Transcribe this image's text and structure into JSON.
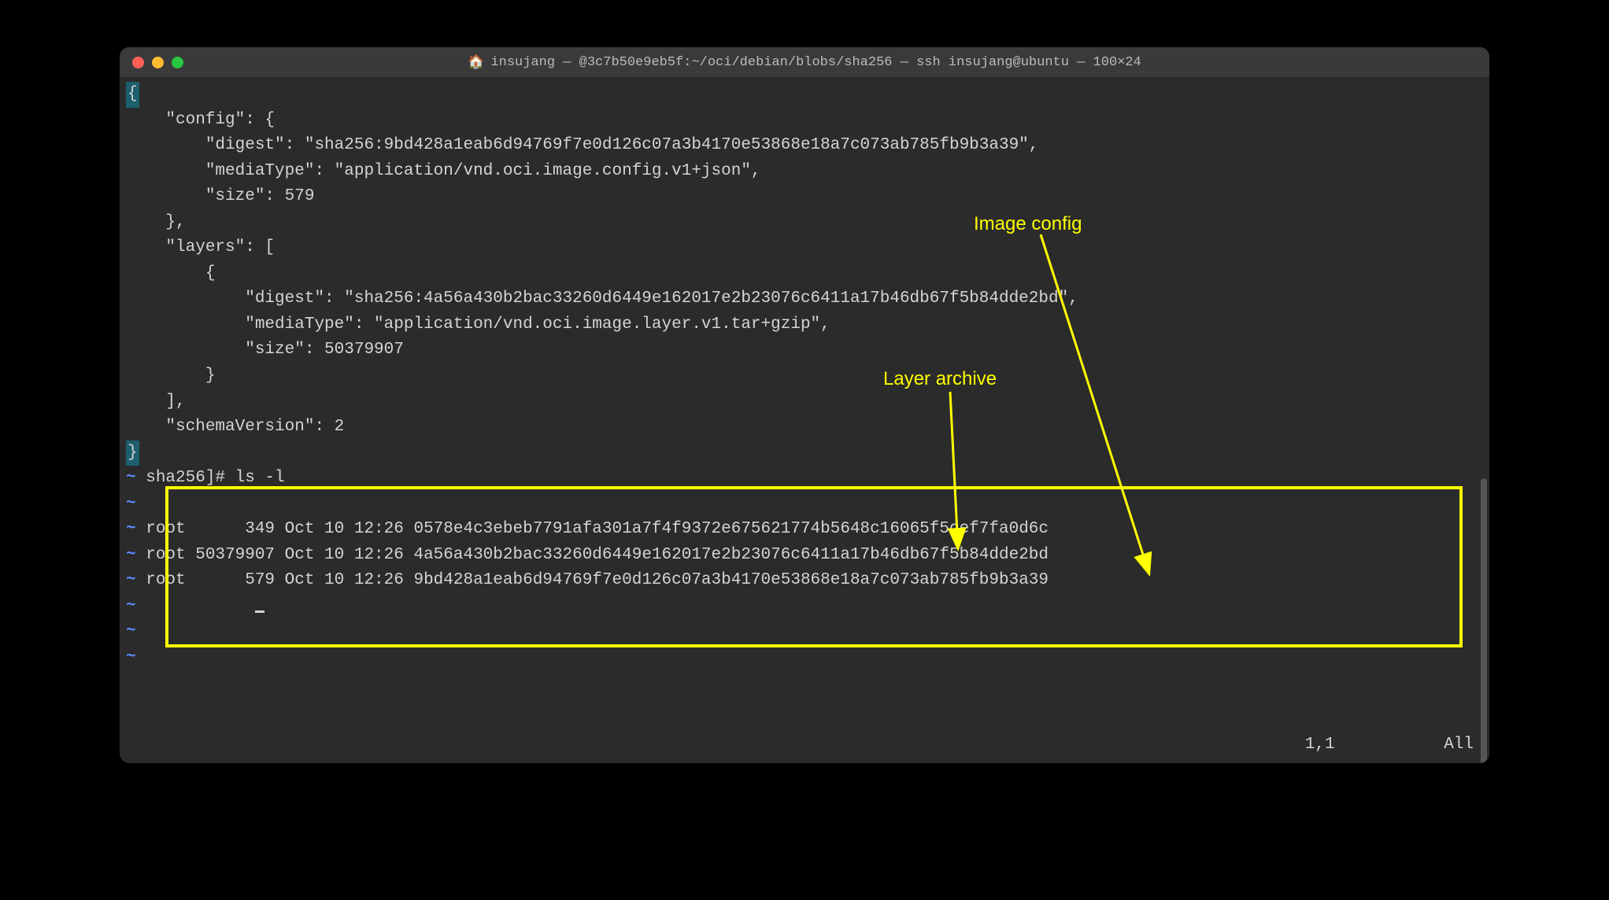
{
  "titlebar": {
    "home_icon": "🏠",
    "title": "insujang — @3c7b50e9eb5f:~/oci/debian/blobs/sha256 — ssh insujang@ubuntu — 100×24"
  },
  "json_output": {
    "open_brace": "{",
    "line1": "    \"config\": {",
    "line2": "        \"digest\": \"sha256:9bd428a1eab6d94769f7e0d126c07a3b4170e53868e18a7c073ab785fb9b3a39\",",
    "line3": "        \"mediaType\": \"application/vnd.oci.image.config.v1+json\",",
    "line4": "        \"size\": 579",
    "line5": "    },",
    "line6": "    \"layers\": [",
    "line7": "        {",
    "line8": "            \"digest\": \"sha256:4a56a430b2bac33260d6449e162017e2b23076c6411a17b46db67f5b84dde2bd\",",
    "line9": "            \"mediaType\": \"application/vnd.oci.image.layer.v1.tar+gzip\",",
    "line10": "            \"size\": 50379907",
    "line11": "        }",
    "line12": "    ],",
    "line13": "    \"schemaVersion\": 2",
    "close_brace": "}"
  },
  "ls_command": {
    "prompt_line": " sha256]# ls -l",
    "blank": "",
    "row1": " root      349 Oct 10 12:26 0578e4c3ebeb7791afa301a7f4f9372e675621774b5648c16065f5cef7fa0d6c",
    "row2": " root 50379907 Oct 10 12:26 4a56a430b2bac33260d6449e162017e2b23076c6411a17b46db67f5b84dde2bd",
    "row3": " root      579 Oct 10 12:26 9bd428a1eab6d94769f7e0d126c07a3b4170e53868e18a7c073ab785fb9b3a39"
  },
  "tilde": "~",
  "status": {
    "position": "1,1",
    "scroll": "All"
  },
  "annotations": {
    "image_config": "Image config",
    "layer_archive": "Layer archive"
  }
}
